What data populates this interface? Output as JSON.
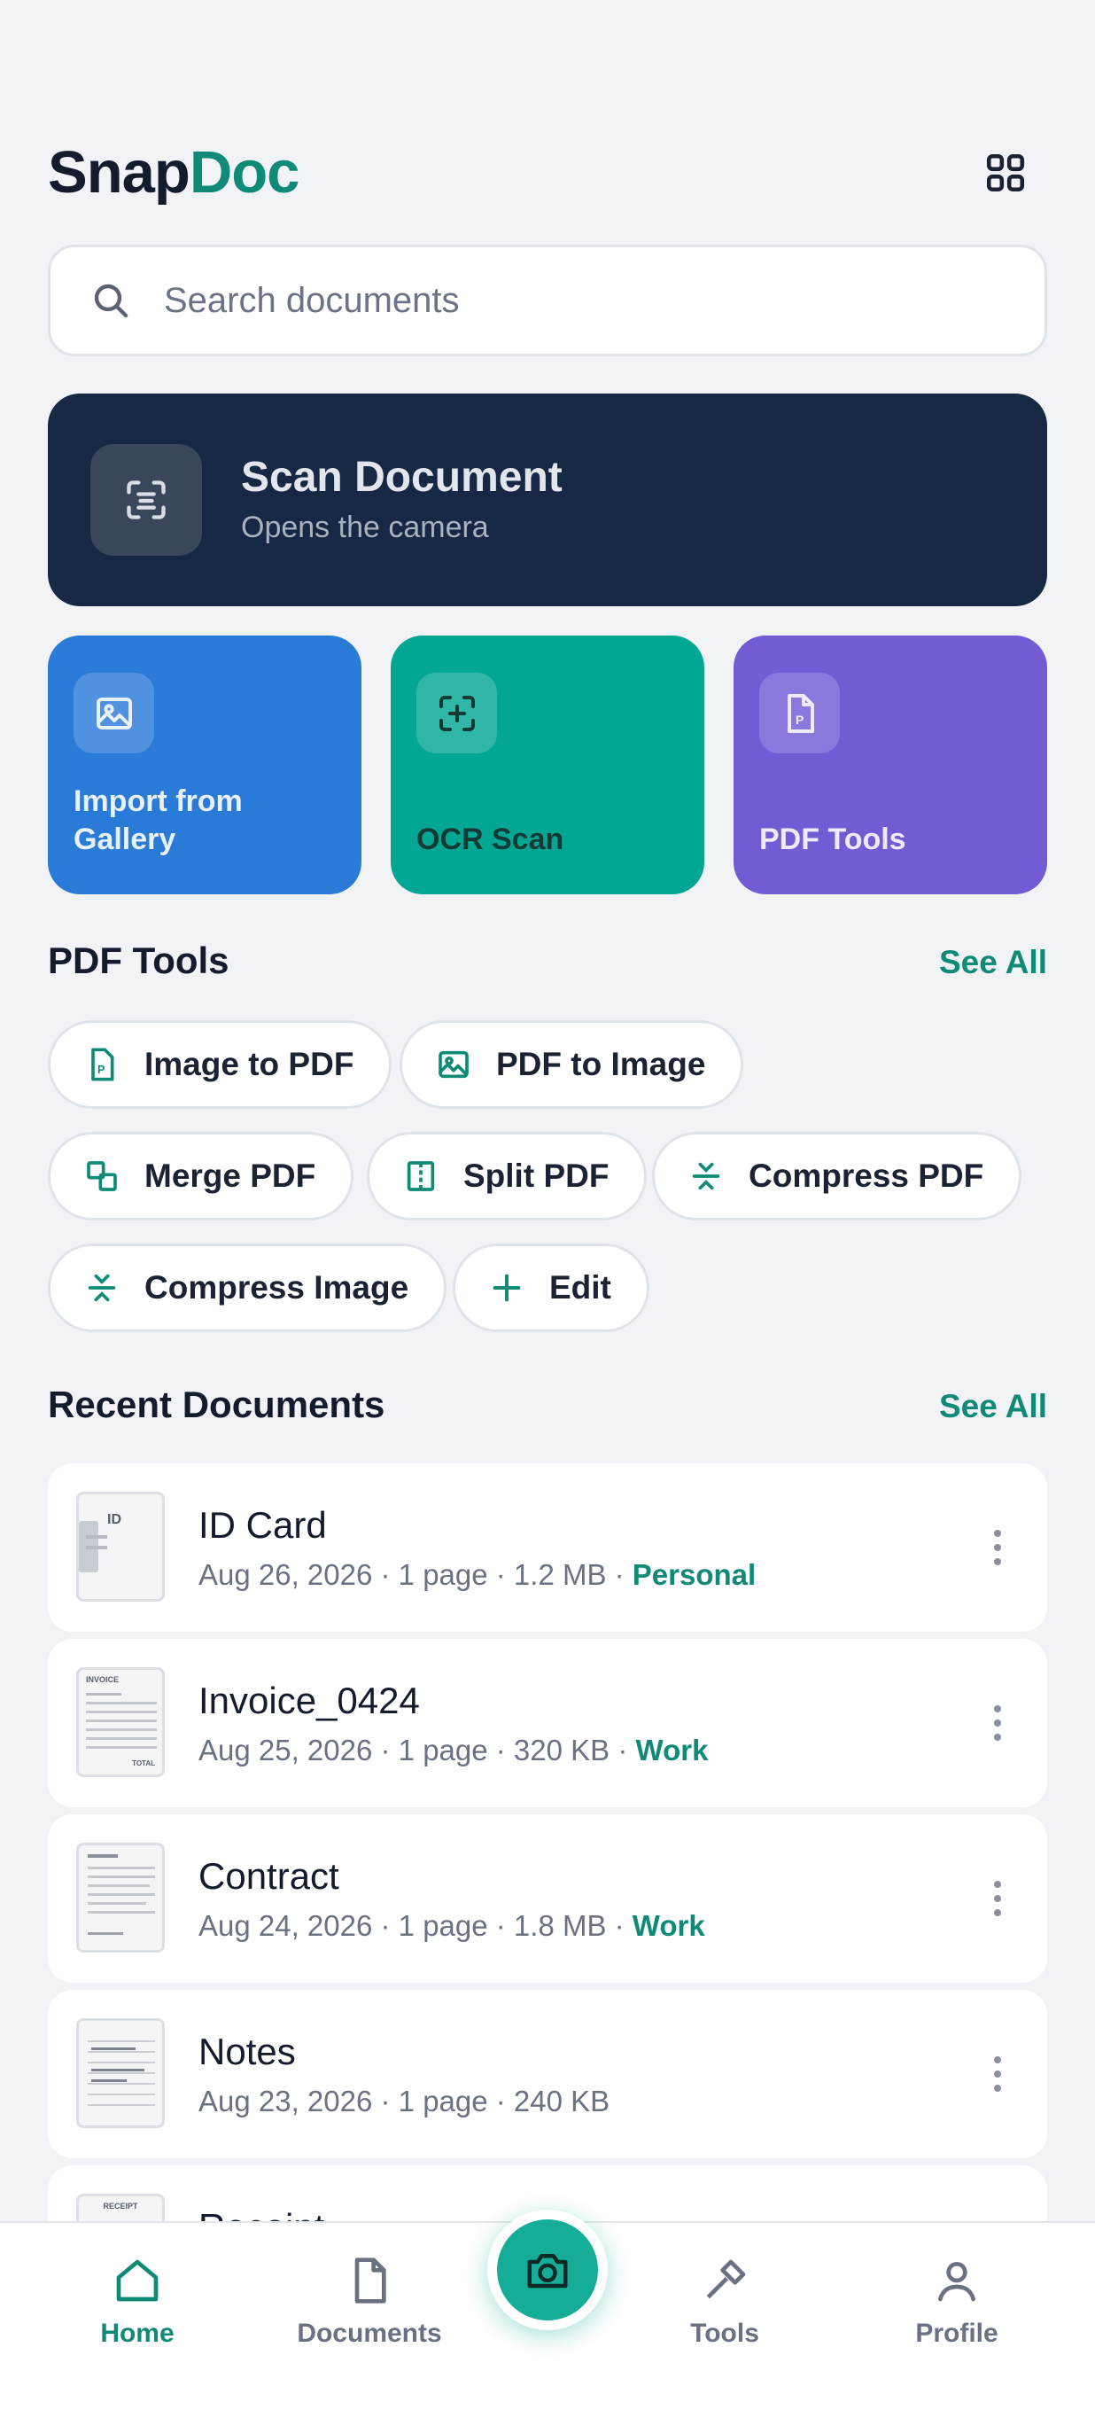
{
  "app": {
    "brand_part1": "Snap",
    "brand_part2": "Doc",
    "accent_color": "#0f8a76",
    "grid_icon": "grid-icon"
  },
  "search": {
    "placeholder": "Search documents",
    "icon": "search-icon"
  },
  "scan_card": {
    "title": "Scan Document",
    "subtitle": "Opens the camera",
    "icon": "scan-icon",
    "color": "#172845"
  },
  "tiles": [
    {
      "label_line1": "Import from",
      "label_line2": "Gallery",
      "icon": "image-icon",
      "color": "#2a7bd8"
    },
    {
      "label": "OCR Scan",
      "icon": "ocr-scan-icon",
      "color": "#03a693"
    },
    {
      "label": "PDF Tools",
      "icon": "pdf-file-icon",
      "color": "#735bd6"
    }
  ],
  "pdf_tools": {
    "title": "PDF Tools",
    "see_all": "See All",
    "chips": [
      {
        "label": "Image to PDF",
        "icon": "pdf-file-icon"
      },
      {
        "label": "PDF to Image",
        "icon": "image-icon"
      },
      {
        "label": "Merge PDF",
        "icon": "merge-icon"
      },
      {
        "label": "Split PDF",
        "icon": "split-icon"
      },
      {
        "label": "Compress PDF",
        "icon": "compress-icon"
      },
      {
        "label": "Compress Image",
        "icon": "compress-icon"
      },
      {
        "label": "Edit",
        "icon": "plus-icon"
      }
    ]
  },
  "recent": {
    "title": "Recent Documents",
    "see_all": "See All",
    "documents": [
      {
        "name": "ID Card",
        "meta": "Aug 26, 2026 · 1 page · 1.2 MB · ",
        "tag": "Personal",
        "thumb_text": "ID"
      },
      {
        "name": "Invoice_0424",
        "meta": "Aug 25, 2026 · 1 page · 320 KB · ",
        "tag": "Work",
        "thumb_text": "INVOICE",
        "thumb_text2": "TOTAL"
      },
      {
        "name": "Contract",
        "meta": "Aug 24, 2026 · 1 page · 1.8 MB · ",
        "tag": "Work"
      },
      {
        "name": "Notes",
        "meta": "Aug 23, 2026 · 1 page · 240 KB",
        "tag": ""
      },
      {
        "name": "Receipt",
        "meta": "",
        "tag": "",
        "thumb_text": "RECEIPT"
      }
    ]
  },
  "bottom_nav": {
    "items": [
      {
        "label": "Home",
        "icon": "home-icon",
        "active": true
      },
      {
        "label": "Documents",
        "icon": "document-icon",
        "active": false
      },
      {
        "label": "Tools",
        "icon": "hammer-icon",
        "active": false
      },
      {
        "label": "Profile",
        "icon": "user-icon",
        "active": false
      }
    ],
    "fab_icon": "camera-icon"
  }
}
